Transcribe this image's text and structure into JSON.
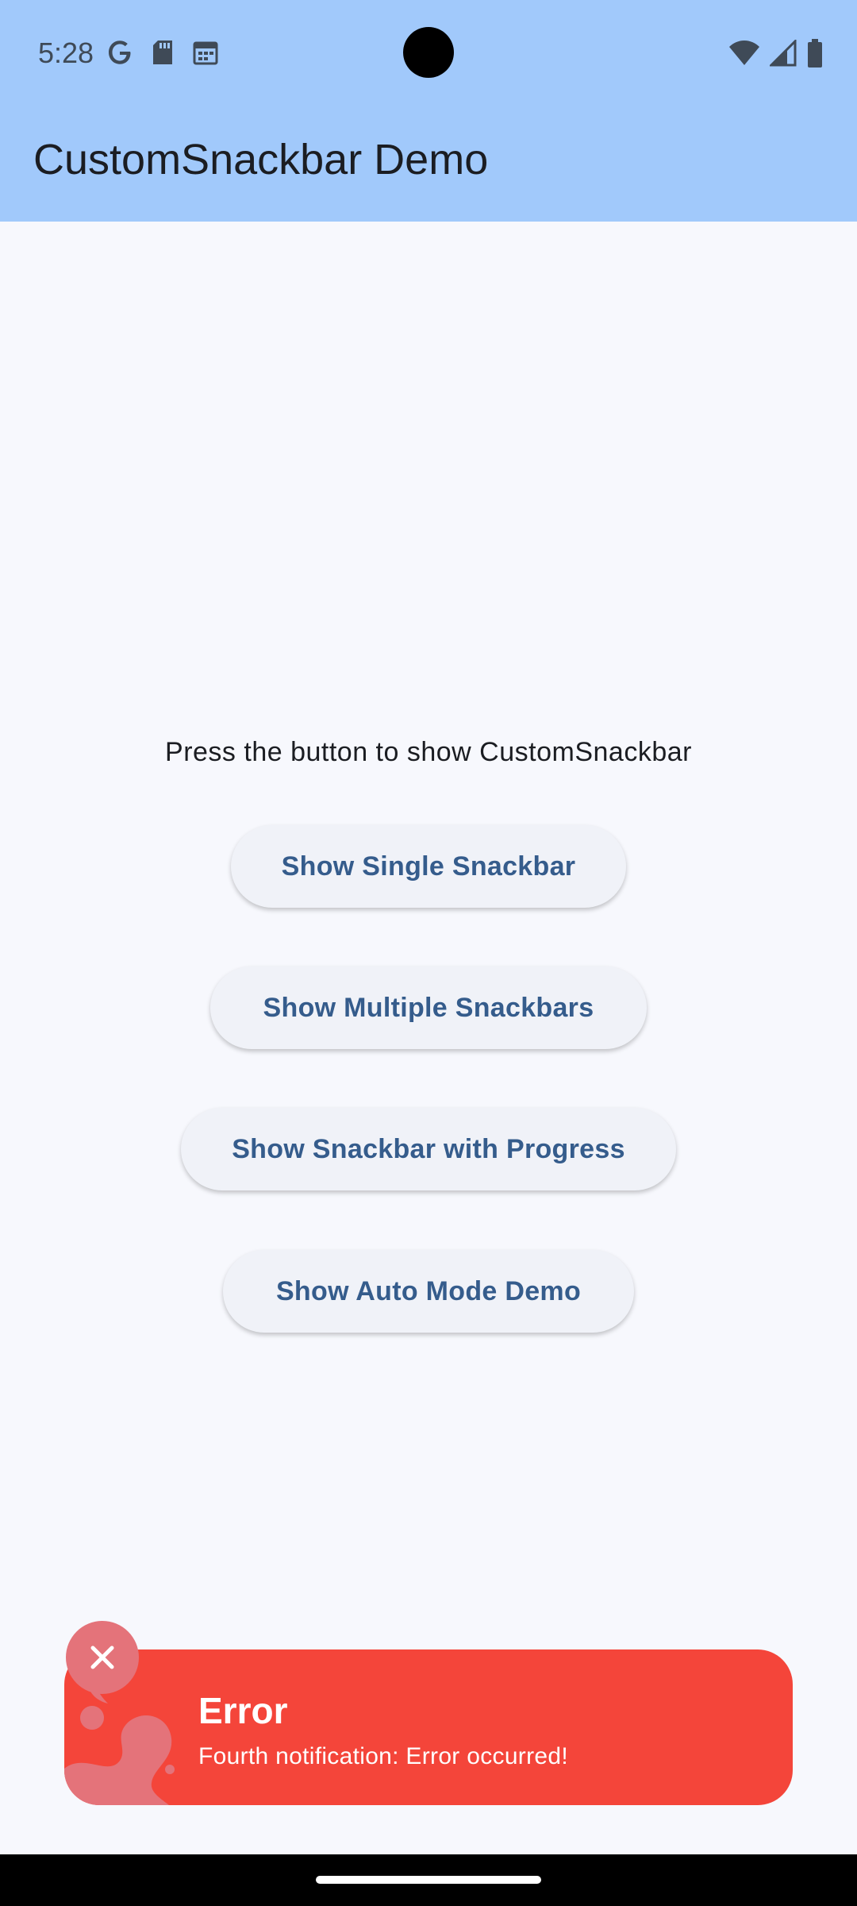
{
  "status_bar": {
    "time": "5:28",
    "left_icons": [
      "google-icon",
      "sd-card-icon",
      "calendar-icon"
    ],
    "right_icons": [
      "wifi-icon",
      "signal-icon",
      "battery-icon"
    ]
  },
  "app_bar": {
    "title": "CustomSnackbar Demo"
  },
  "main": {
    "prompt": "Press the button to show CustomSnackbar",
    "buttons": [
      {
        "label": "Show Single Snackbar"
      },
      {
        "label": "Show Multiple Snackbars"
      },
      {
        "label": "Show Snackbar with Progress"
      },
      {
        "label": "Show Auto Mode Demo"
      }
    ]
  },
  "snackbar": {
    "title": "Error",
    "message": "Fourth notification: Error occurred!",
    "color": "#f4453a",
    "close_icon": "close-icon"
  },
  "colors": {
    "app_bar": "#a1c9fb",
    "background": "#f7f8fd",
    "button_text": "#355c8c"
  }
}
